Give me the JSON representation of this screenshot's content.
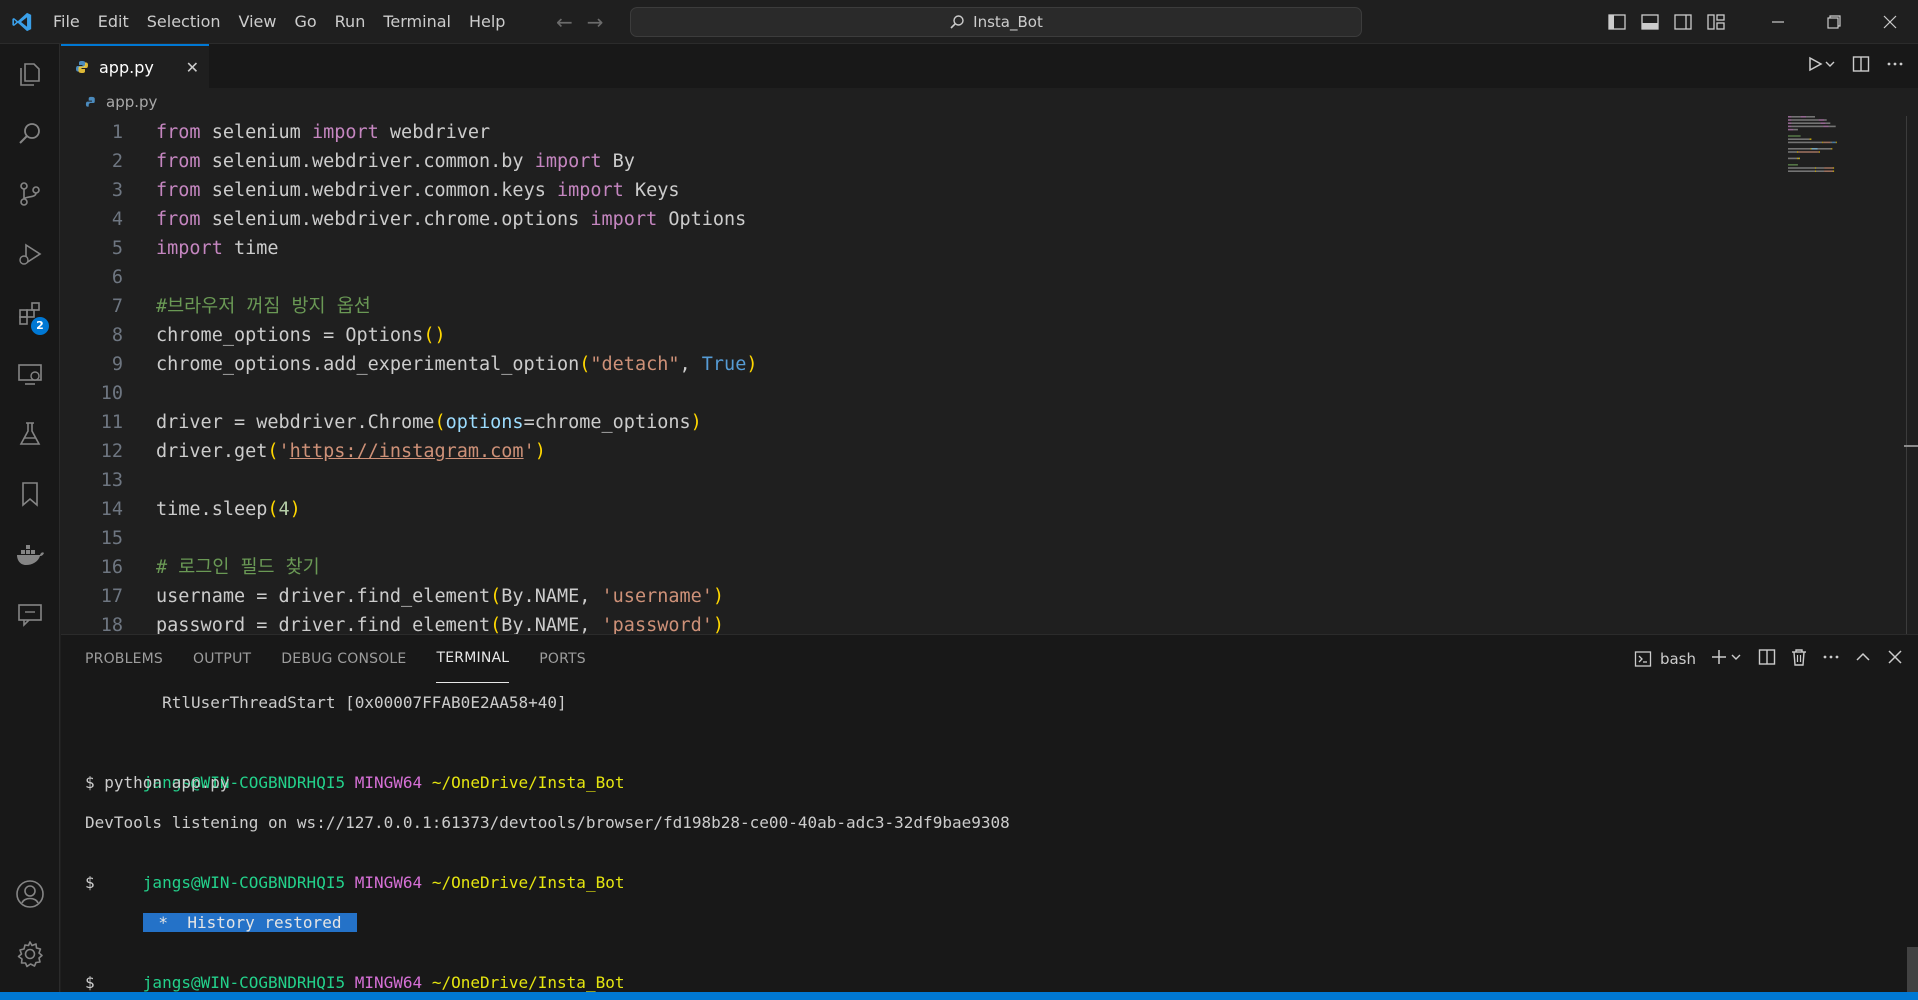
{
  "menu": [
    "File",
    "Edit",
    "Selection",
    "View",
    "Go",
    "Run",
    "Terminal",
    "Help"
  ],
  "command_center": {
    "label": "Insta_Bot"
  },
  "activity_bar": {
    "extensions_badge": "2"
  },
  "tabs": [
    {
      "label": "app.py",
      "close": "✕"
    }
  ],
  "breadcrumb": {
    "file": "app.py"
  },
  "editor": {
    "line_numbers": [
      "1",
      "2",
      "3",
      "4",
      "5",
      "6",
      "7",
      "8",
      "9",
      "10",
      "11",
      "12",
      "13",
      "14",
      "15",
      "16",
      "17",
      "18"
    ],
    "lines": [
      [
        [
          "kw",
          "from"
        ],
        [
          "id",
          " selenium "
        ],
        [
          "kw",
          "import"
        ],
        [
          "id",
          " webdriver"
        ]
      ],
      [
        [
          "kw",
          "from"
        ],
        [
          "id",
          " selenium.webdriver.common.by "
        ],
        [
          "kw",
          "import"
        ],
        [
          "id",
          " By"
        ]
      ],
      [
        [
          "kw",
          "from"
        ],
        [
          "id",
          " selenium.webdriver.common.keys "
        ],
        [
          "kw",
          "import"
        ],
        [
          "id",
          " Keys"
        ]
      ],
      [
        [
          "kw",
          "from"
        ],
        [
          "id",
          " selenium.webdriver.chrome.options "
        ],
        [
          "kw",
          "import"
        ],
        [
          "id",
          " Options"
        ]
      ],
      [
        [
          "kw",
          "import"
        ],
        [
          "id",
          " time"
        ]
      ],
      [],
      [
        [
          "cmt",
          "#브라우저 꺼짐 방지 옵션"
        ]
      ],
      [
        [
          "id",
          "chrome_options = Options"
        ],
        [
          "br",
          "()"
        ]
      ],
      [
        [
          "id",
          "chrome_options.add_experimental_option"
        ],
        [
          "br",
          "("
        ],
        [
          "str",
          "\"detach\""
        ],
        [
          "id",
          ", "
        ],
        [
          "kv",
          "True"
        ],
        [
          "br",
          ")"
        ]
      ],
      [],
      [
        [
          "id",
          "driver = webdriver.Chrome"
        ],
        [
          "br",
          "("
        ],
        [
          "param",
          "options"
        ],
        [
          "id",
          "=chrome_options"
        ],
        [
          "br",
          ")"
        ]
      ],
      [
        [
          "id",
          "driver.get"
        ],
        [
          "br",
          "("
        ],
        [
          "str",
          "'"
        ],
        [
          "url",
          "https://instagram.com"
        ],
        [
          "str",
          "'"
        ],
        [
          "br",
          ")"
        ]
      ],
      [],
      [
        [
          "id",
          "time.sleep"
        ],
        [
          "br",
          "("
        ],
        [
          "num",
          "4"
        ],
        [
          "br",
          ")"
        ]
      ],
      [],
      [
        [
          "cmt",
          "# 로그인 필드 찾기"
        ]
      ],
      [
        [
          "id",
          "username = driver.find_element"
        ],
        [
          "br",
          "("
        ],
        [
          "id",
          "By.NAME, "
        ],
        [
          "str",
          "'username'"
        ],
        [
          "br",
          ")"
        ]
      ],
      [
        [
          "id",
          "password = driver.find_element"
        ],
        [
          "br",
          "("
        ],
        [
          "id",
          "By.NAME, "
        ],
        [
          "str",
          "'password'"
        ],
        [
          "br",
          ")"
        ]
      ]
    ]
  },
  "panel": {
    "tabs": [
      "PROBLEMS",
      "OUTPUT",
      "DEBUG CONSOLE",
      "TERMINAL",
      "PORTS"
    ],
    "active_tab": "TERMINAL",
    "terminal_profile": "bash"
  },
  "terminal": {
    "stack_line": "        RtlUserThreadStart [0x00007FFAB0E2AA58+40]",
    "prompt_user": "jangs@WIN-COGBNDRHQI5",
    "prompt_mingw": "MINGW64",
    "prompt_path": "~/OneDrive/Insta_Bot",
    "command": "$ python app.py",
    "devtools": "DevTools listening on ws://127.0.0.1:61373/devtools/browser/fd198b28-ce00-40ab-adc3-32df9bae9308",
    "dollar": "$",
    "history_restored": " *  History restored "
  },
  "colors": {
    "accent": "#0078d4",
    "keyword": "#c586c0",
    "string": "#ce9178",
    "comment": "#6a9955",
    "bracket": "#ffd700"
  }
}
